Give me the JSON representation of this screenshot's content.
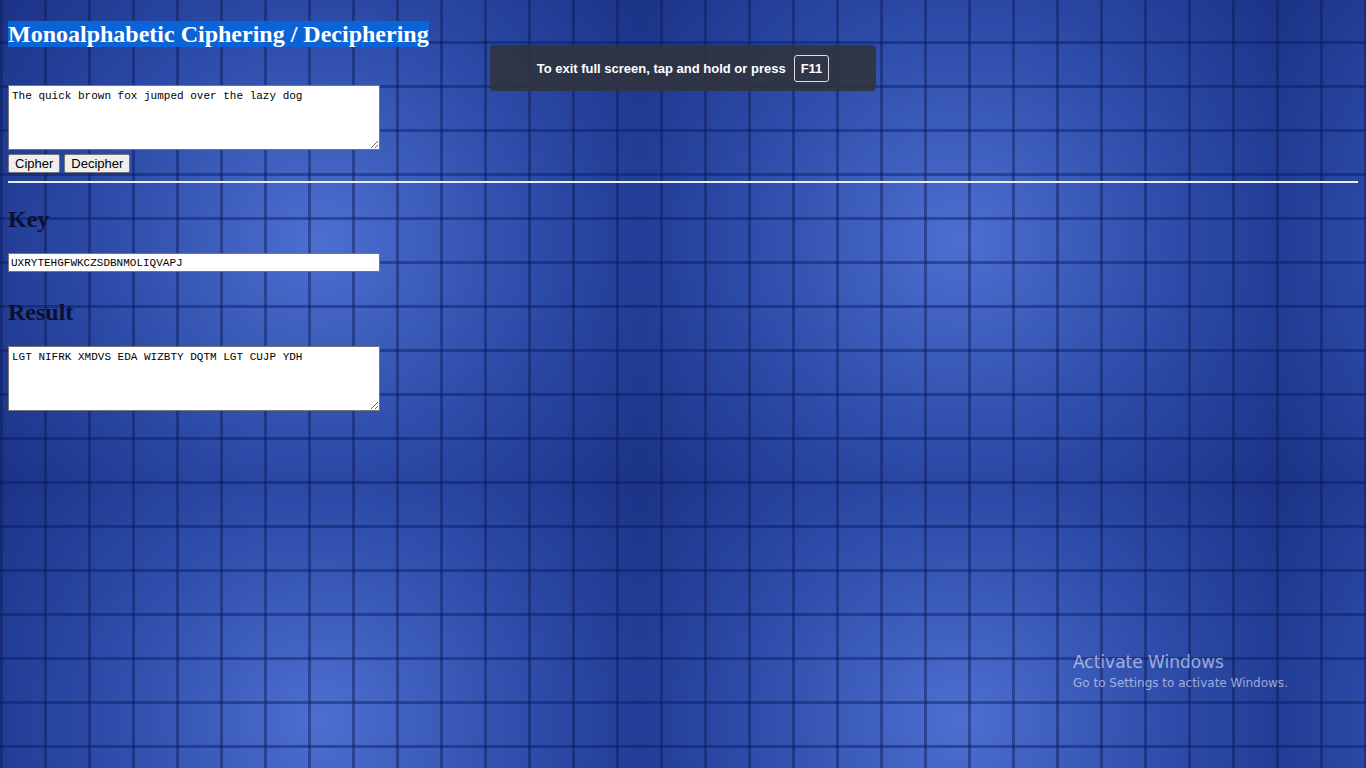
{
  "page": {
    "title": "Monoalphabetic Ciphering / Deciphering",
    "title_selected": true
  },
  "input": {
    "value": "The quick brown fox jumped over the lazy dog"
  },
  "buttons": [
    {
      "label": "Cipher"
    },
    {
      "label": "Decipher"
    }
  ],
  "key": {
    "heading": "Key",
    "value": "UXRYTEHGFWKCZSDBNMOLIQVAPJ"
  },
  "result": {
    "heading": "Result",
    "value": "LGT NIFRK XMDVS EDA WIZBTY DQTM LGT CUJP YDH"
  },
  "fullscreen_notice": {
    "text": "To exit full screen, tap and hold or press",
    "key": "F11"
  },
  "watermark": {
    "title": "Activate Windows",
    "subtitle": "Go to Settings to activate Windows."
  }
}
